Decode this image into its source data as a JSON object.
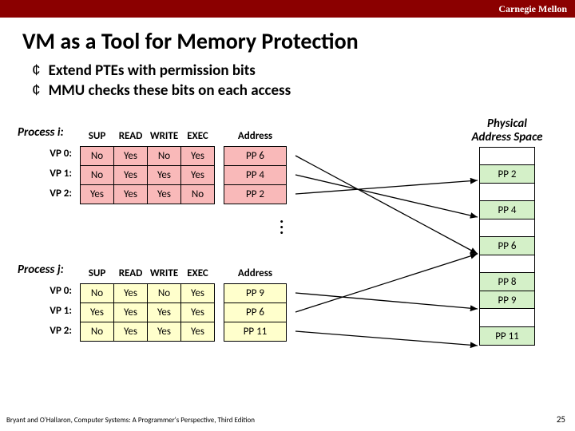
{
  "header": {
    "brand": "Carnegie Mellon"
  },
  "title": "VM as a Tool for Memory Protection",
  "bullets": [
    "Extend PTEs with permission bits",
    "MMU checks these bits on each access"
  ],
  "cols": {
    "sup": "SUP",
    "read": "READ",
    "write": "WRITE",
    "exec": "EXEC",
    "addr": "Address"
  },
  "proc_i": {
    "label": "Process i:",
    "vp_labels": [
      "VP 0:",
      "VP 1:",
      "VP 2:"
    ],
    "rows": [
      {
        "sup": "No",
        "read": "Yes",
        "write": "No",
        "exec": "Yes",
        "addr": "PP 6"
      },
      {
        "sup": "No",
        "read": "Yes",
        "write": "Yes",
        "exec": "Yes",
        "addr": "PP 4"
      },
      {
        "sup": "Yes",
        "read": "Yes",
        "write": "Yes",
        "exec": "No",
        "addr": "PP 2"
      }
    ]
  },
  "proc_j": {
    "label": "Process j:",
    "vp_labels": [
      "VP 0:",
      "VP 1:",
      "VP 2:"
    ],
    "rows": [
      {
        "sup": "No",
        "read": "Yes",
        "write": "No",
        "exec": "Yes",
        "addr": "PP 9"
      },
      {
        "sup": "Yes",
        "read": "Yes",
        "write": "Yes",
        "exec": "Yes",
        "addr": "PP 6"
      },
      {
        "sup": "No",
        "read": "Yes",
        "write": "Yes",
        "exec": "Yes",
        "addr": "PP 11"
      }
    ]
  },
  "phys": {
    "label_l1": "Physical",
    "label_l2": "Address Space",
    "pages": [
      "",
      "PP 2",
      "",
      "PP 4",
      "",
      "PP 6",
      "",
      "PP 8",
      "PP 9",
      "",
      "PP 11"
    ]
  },
  "footer": "Bryant and O'Hallaron, Computer Systems: A Programmer's Perspective, Third Edition",
  "page": "25"
}
